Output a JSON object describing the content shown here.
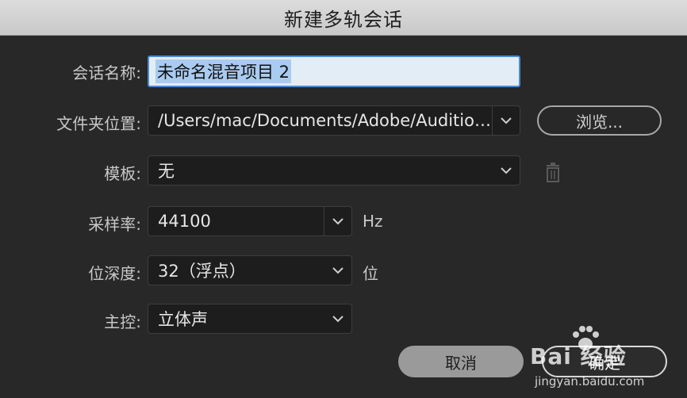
{
  "dialog": {
    "title": "新建多轨会话"
  },
  "form": {
    "session_name": {
      "label": "会话名称:",
      "value": "未命名混音项目 2"
    },
    "folder": {
      "label": "文件夹位置:",
      "value": "/Users/mac/Documents/Adobe/Audition...",
      "browse_label": "浏览..."
    },
    "template": {
      "label": "模板:",
      "value": "无"
    },
    "sample_rate": {
      "label": "采样率:",
      "value": "44100",
      "unit": "Hz"
    },
    "bit_depth": {
      "label": "位深度:",
      "value": "32（浮点）",
      "unit": "位"
    },
    "master": {
      "label": "主控:",
      "value": "立体声"
    }
  },
  "buttons": {
    "cancel": "取消",
    "ok": "确定"
  },
  "watermark": {
    "brand": "Bai 经验",
    "url": "jingyan.baidu.com"
  },
  "icons": {
    "dropdown": "chevron-down-icon",
    "trash": "trash-icon"
  },
  "colors": {
    "background": "#282828",
    "input_focus_border": "#4a8ad3",
    "selection": "#a9cbf0"
  }
}
